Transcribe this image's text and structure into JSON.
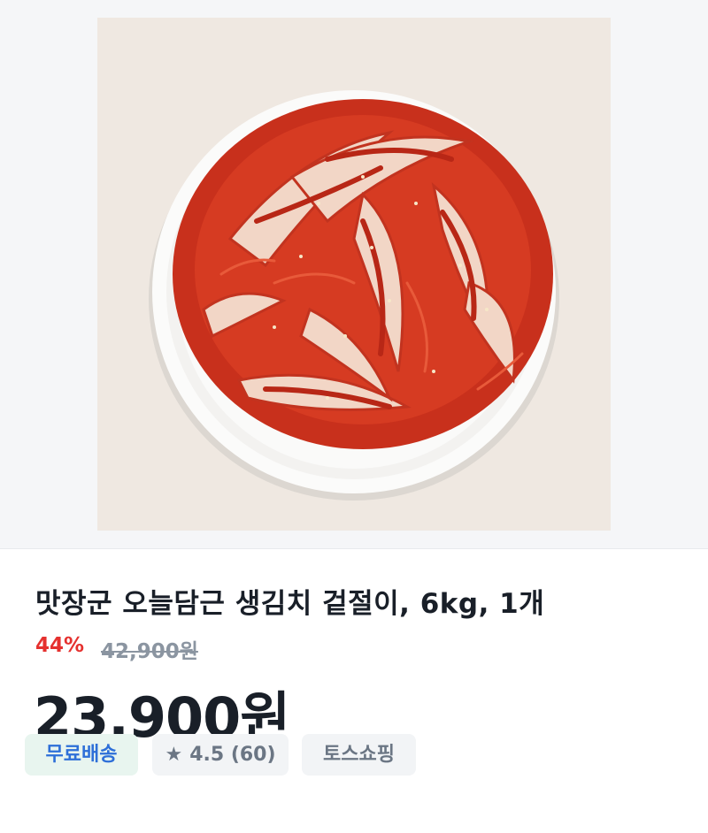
{
  "product": {
    "image_alt": "kimchi on a white plate",
    "title": "맛장군 오늘담근 생김치 겉절이, 6kg, 1개",
    "discount_rate": "44%",
    "original_price": "42,900원",
    "price": "23,900원"
  },
  "badges": {
    "shipping": "무료배송",
    "rating_icon": "star-icon",
    "rating": "4.5 (60)",
    "store": "토스쇼핑"
  },
  "colors": {
    "discount": "#e5312f",
    "shipping_text": "#2d6fd8",
    "shipping_bg": "#e8f5ef"
  }
}
